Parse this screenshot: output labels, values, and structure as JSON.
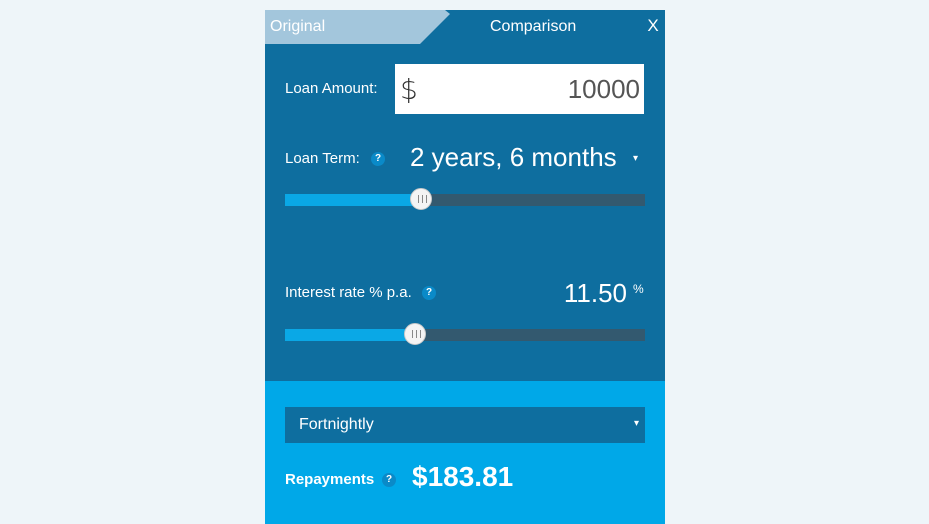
{
  "tabs": {
    "original_label": "Original",
    "comparison_label": "Comparison",
    "close_label": "X"
  },
  "loan_amount": {
    "label": "Loan Amount:",
    "currency_symbol": "$",
    "value": "10000"
  },
  "loan_term": {
    "label": "Loan Term:",
    "help_icon": "?",
    "value": "2 years, 6 months",
    "caret": "▾",
    "slider_fraction": 0.38
  },
  "interest_rate": {
    "label": "Interest rate % p.a.",
    "help_icon": "?",
    "value": "11.50",
    "unit": "%",
    "slider_fraction": 0.365
  },
  "frequency": {
    "selected": "Fortnightly",
    "caret": "▾"
  },
  "repayments": {
    "label": "Repayments",
    "help_icon": "?",
    "value": "$183.81"
  },
  "colors": {
    "panel": "#0e6e9f",
    "bottom": "#00a8e8",
    "tab_inactive": "#a3c6dc",
    "slider_fill": "#0aa8e6",
    "slider_track": "#33596f"
  }
}
